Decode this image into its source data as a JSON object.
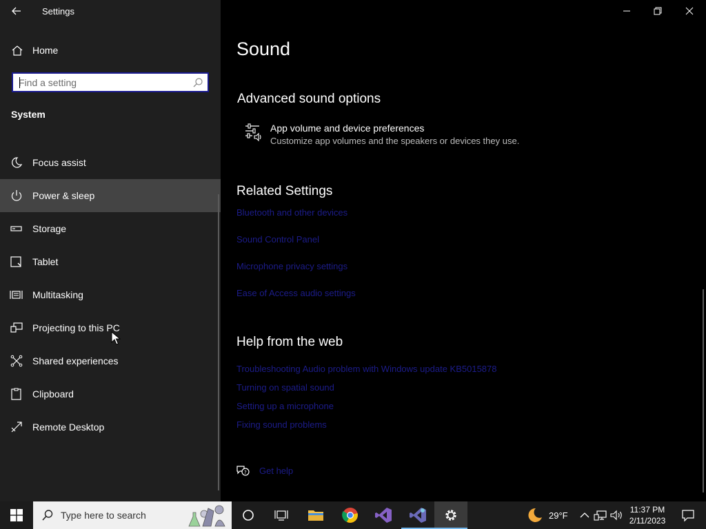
{
  "window": {
    "title": "Settings"
  },
  "sidebar": {
    "home_label": "Home",
    "search_placeholder": "Find a setting",
    "section_title": "System",
    "items": [
      {
        "label": "Focus assist",
        "icon": "moon-icon"
      },
      {
        "label": "Power & sleep",
        "icon": "power-icon",
        "selected": true
      },
      {
        "label": "Storage",
        "icon": "storage-icon"
      },
      {
        "label": "Tablet",
        "icon": "tablet-icon"
      },
      {
        "label": "Multitasking",
        "icon": "multitasking-icon"
      },
      {
        "label": "Projecting to this PC",
        "icon": "projecting-icon"
      },
      {
        "label": "Shared experiences",
        "icon": "shared-experiences-icon"
      },
      {
        "label": "Clipboard",
        "icon": "clipboard-icon"
      },
      {
        "label": "Remote Desktop",
        "icon": "remote-desktop-icon"
      }
    ]
  },
  "main": {
    "page_title": "Sound",
    "advanced": {
      "title": "Advanced sound options",
      "item_title": "App volume and device preferences",
      "item_desc": "Customize app volumes and the speakers or devices they use."
    },
    "related": {
      "title": "Related Settings",
      "links": [
        "Bluetooth and other devices",
        "Sound Control Panel",
        "Microphone privacy settings",
        "Ease of Access audio settings"
      ]
    },
    "help": {
      "title": "Help from the web",
      "links": [
        "Troubleshooting Audio problem with Windows update KB5015878",
        "Turning on spatial sound",
        "Setting up a microphone",
        "Fixing sound problems"
      ]
    },
    "get_help": "Get help"
  },
  "taskbar": {
    "search_text": "Type here to search",
    "weather_temp": "29°F",
    "clock_time": "11:37 PM",
    "clock_date": "2/11/2023"
  },
  "colors": {
    "sidebar_bg": "#1f1f1f",
    "selected_bg": "#444444",
    "link": "#1c1c8a",
    "taskbar_bg": "#1c1c1c",
    "accent": "#76b9ed"
  }
}
